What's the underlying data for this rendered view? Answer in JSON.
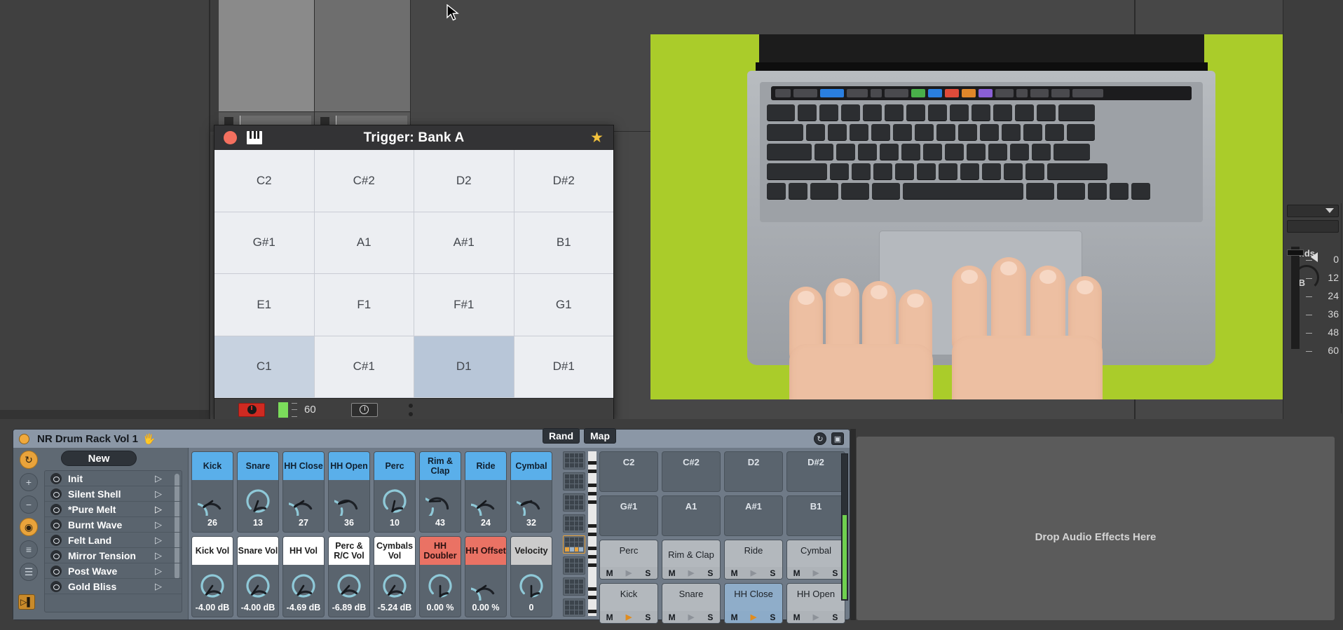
{
  "trigger_window": {
    "title": "Trigger: Bank A",
    "icons": {
      "record": "record-dot-icon",
      "keyboard": "piano-keys-icon",
      "favorite": "star-icon"
    },
    "pads": [
      {
        "label": "C2",
        "state": "normal"
      },
      {
        "label": "C#2",
        "state": "normal"
      },
      {
        "label": "D2",
        "state": "normal"
      },
      {
        "label": "D#2",
        "state": "normal"
      },
      {
        "label": "G#1",
        "state": "normal"
      },
      {
        "label": "A1",
        "state": "normal"
      },
      {
        "label": "A#1",
        "state": "normal"
      },
      {
        "label": "B1",
        "state": "normal"
      },
      {
        "label": "E1",
        "state": "normal"
      },
      {
        "label": "F1",
        "state": "normal"
      },
      {
        "label": "F#1",
        "state": "normal"
      },
      {
        "label": "G1",
        "state": "normal"
      },
      {
        "label": "C1",
        "state": "halfsel"
      },
      {
        "label": "C#1",
        "state": "normal"
      },
      {
        "label": "D1",
        "state": "selected"
      },
      {
        "label": "D#1",
        "state": "normal"
      }
    ],
    "footer": {
      "tempo": "60"
    }
  },
  "device": {
    "name": "NR Drum Rack Vol 1",
    "hand_icon": "hand-icon",
    "header_buttons": [
      {
        "name": "hot-swap-icon",
        "glyph": "↻"
      },
      {
        "name": "save-preset-icon",
        "glyph": "▣"
      }
    ],
    "new_button": "New",
    "presets": [
      {
        "label": "Init",
        "active": false
      },
      {
        "label": "Silent Shell",
        "active": false
      },
      {
        "label": "*Pure Melt",
        "active": true
      },
      {
        "label": "Burnt Wave",
        "active": false
      },
      {
        "label": "Felt Land",
        "active": false
      },
      {
        "label": "Mirror Tension",
        "active": false
      },
      {
        "label": "Post Wave",
        "active": false
      },
      {
        "label": "Gold Bliss",
        "active": false
      }
    ],
    "side_icons": [
      {
        "name": "hot-swap-circle-icon",
        "glyph": "↻",
        "active": true
      },
      {
        "name": "add-macro-icon",
        "glyph": "+",
        "active": false
      },
      {
        "name": "remove-macro-icon",
        "glyph": "−",
        "active": false
      },
      {
        "name": "camera-snapshot-icon",
        "glyph": "◉",
        "active": true
      },
      {
        "name": "variation-icon",
        "glyph": "≡",
        "active": false
      },
      {
        "name": "list-view-icon",
        "glyph": "☰",
        "active": false
      }
    ],
    "play_icon": "chain-play-icon",
    "rand_button": "Rand",
    "map_button": "Map",
    "macros_row1": [
      {
        "label": "Kick",
        "value": "26",
        "color": "blue",
        "angle": 235
      },
      {
        "label": "Snare",
        "value": "13",
        "color": "blue",
        "angle": 200
      },
      {
        "label": "HH Close",
        "value": "27",
        "color": "blue",
        "angle": 237
      },
      {
        "label": "HH Open",
        "value": "36",
        "color": "blue",
        "angle": 255
      },
      {
        "label": "Perc",
        "value": "10",
        "color": "blue",
        "angle": 193
      },
      {
        "label": "Rim & Clap",
        "value": "43",
        "color": "blue",
        "angle": 268
      },
      {
        "label": "Ride",
        "value": "24",
        "color": "blue",
        "angle": 230
      },
      {
        "label": "Cymbal",
        "value": "32",
        "color": "blue",
        "angle": 248
      }
    ],
    "macros_row2": [
      {
        "label": "Kick Vol",
        "value": "-4.00 dB",
        "color": "white",
        "angle": 215
      },
      {
        "label": "Snare Vol",
        "value": "-4.00 dB",
        "color": "white",
        "angle": 215
      },
      {
        "label": "HH Vol",
        "value": "-4.69 dB",
        "color": "white",
        "angle": 212
      },
      {
        "label": "Perc & R/C Vol",
        "value": "-6.89 dB",
        "color": "white",
        "angle": 222
      },
      {
        "label": "Cymbals Vol",
        "value": "-5.24 dB",
        "color": "white",
        "angle": 214
      },
      {
        "label": "HH Doubler",
        "value": "0.00 %",
        "color": "red",
        "angle": 180
      },
      {
        "label": "HH Offset",
        "value": "0.00 %",
        "color": "red",
        "angle": 236
      },
      {
        "label": "Velocity",
        "value": "0",
        "color": "grey",
        "angle": 180
      }
    ],
    "drum_pads": [
      {
        "label": "C2",
        "filled": false,
        "selected": false,
        "mute": "M",
        "solo": "S",
        "play": false
      },
      {
        "label": "C#2",
        "filled": false,
        "selected": false,
        "mute": "M",
        "solo": "S",
        "play": false
      },
      {
        "label": "D2",
        "filled": false,
        "selected": false,
        "mute": "M",
        "solo": "S",
        "play": false
      },
      {
        "label": "D#2",
        "filled": false,
        "selected": false,
        "mute": "M",
        "solo": "S",
        "play": false
      },
      {
        "label": "G#1",
        "filled": false,
        "selected": false,
        "mute": "M",
        "solo": "S",
        "play": false
      },
      {
        "label": "A1",
        "filled": false,
        "selected": false,
        "mute": "M",
        "solo": "S",
        "play": false
      },
      {
        "label": "A#1",
        "filled": false,
        "selected": false,
        "mute": "M",
        "solo": "S",
        "play": false
      },
      {
        "label": "B1",
        "filled": false,
        "selected": false,
        "mute": "M",
        "solo": "S",
        "play": false
      },
      {
        "label": "Perc",
        "filled": true,
        "selected": false,
        "mute": "M",
        "solo": "S",
        "play": false
      },
      {
        "label": "Rim & Clap",
        "filled": true,
        "selected": false,
        "mute": "M",
        "solo": "S",
        "play": false
      },
      {
        "label": "Ride",
        "filled": true,
        "selected": false,
        "mute": "M",
        "solo": "S",
        "play": false
      },
      {
        "label": "Cymbal",
        "filled": true,
        "selected": false,
        "mute": "M",
        "solo": "S",
        "play": false
      },
      {
        "label": "Kick",
        "filled": true,
        "selected": false,
        "mute": "M",
        "solo": "S",
        "play": true
      },
      {
        "label": "Snare",
        "filled": true,
        "selected": false,
        "mute": "M",
        "solo": "S",
        "play": false
      },
      {
        "label": "HH Close",
        "filled": true,
        "selected": true,
        "mute": "M",
        "solo": "S",
        "play": true
      },
      {
        "label": "HH Open",
        "filled": true,
        "selected": false,
        "mute": "M",
        "solo": "S",
        "play": false
      }
    ],
    "drop_area_text": "Drop Audio Effects Here"
  },
  "mixer": {
    "sends_label": "ends",
    "scale_marks": [
      "0",
      "12",
      "24",
      "36",
      "48",
      "60"
    ],
    "volume_db": "B"
  },
  "colors": {
    "accent_blue": "#5aafea",
    "macro_red": "#ea7264",
    "device_titlebar": "#8b97a6",
    "device_body": "#6f7a87",
    "video_bg": "#aacc2a",
    "orange_led": "#f0a93c"
  }
}
